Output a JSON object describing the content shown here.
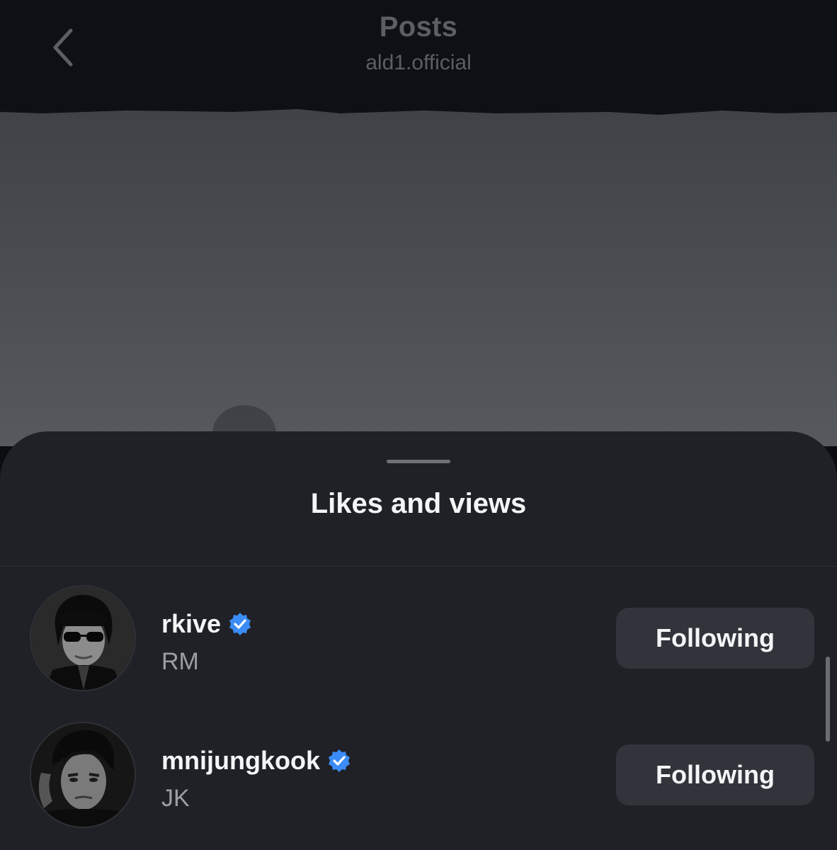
{
  "header": {
    "back_icon": "chevron-left-icon",
    "title": "Posts",
    "subtitle": "ald1.official"
  },
  "sheet": {
    "title": "Likes and views",
    "users": [
      {
        "username": "rkive",
        "verified_icon": "verified-badge-icon",
        "full_name": "RM",
        "button_label": "Following"
      },
      {
        "username": "mnijungkook",
        "verified_icon": "verified-badge-icon",
        "full_name": "JK",
        "button_label": "Following"
      }
    ]
  },
  "colors": {
    "sheet_background": "#1f2126",
    "button_background": "#31343a",
    "verified_blue": "#3b8cf6",
    "header_text_dimmed": "#5b5e63"
  }
}
